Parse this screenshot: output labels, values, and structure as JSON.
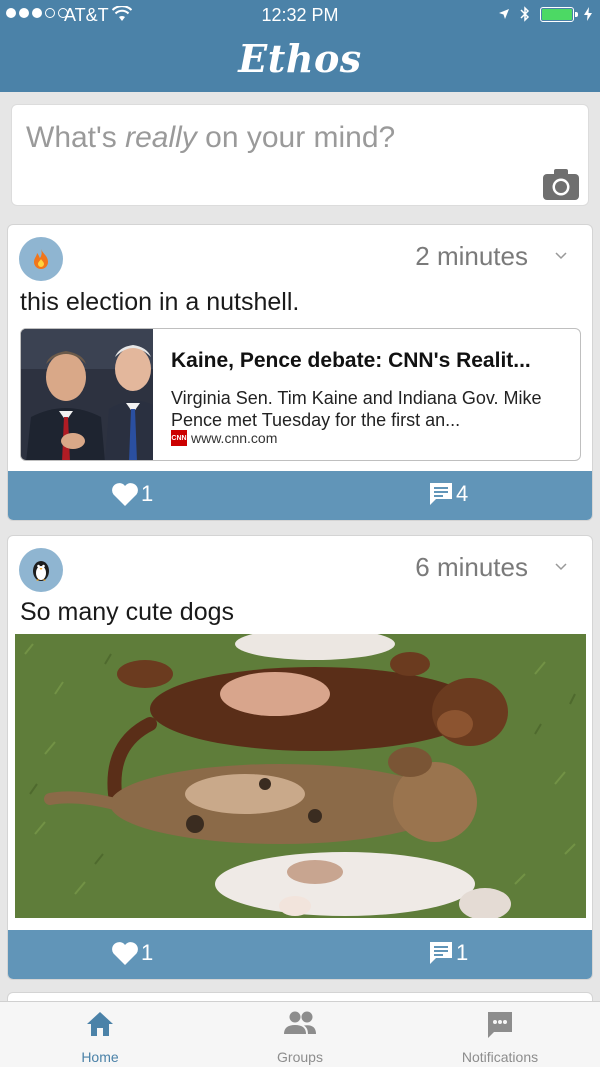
{
  "status_bar": {
    "carrier": "AT&T",
    "time": "12:32 PM"
  },
  "app": {
    "title": "Ethos"
  },
  "composer": {
    "placeholder_before": "What's ",
    "placeholder_emphasis": "really",
    "placeholder_after": " on your mind?",
    "camera_icon": "camera-icon"
  },
  "posts": [
    {
      "avatar_icon": "flame-icon",
      "time_ago": "2 minutes",
      "text": "this election in a nutshell.",
      "link": {
        "title": "Kaine, Pence debate: CNN's Realit...",
        "description": "Virginia Sen. Tim Kaine and Indiana Gov. Mike Pence met Tuesday for the first an...",
        "domain": "www.cnn.com",
        "badge": "CNN"
      },
      "likes": "1",
      "comments": "4"
    },
    {
      "avatar_icon": "penguin-icon",
      "time_ago": "6 minutes",
      "text": "So many cute dogs",
      "likes": "1",
      "comments": "1"
    }
  ],
  "tabs": [
    {
      "label": "Home",
      "icon": "home-icon",
      "active": true
    },
    {
      "label": "Groups",
      "icon": "groups-icon",
      "active": false
    },
    {
      "label": "Notifications",
      "icon": "chat-icon",
      "active": false
    }
  ],
  "colors": {
    "header": "#4b82a8",
    "action_bar": "#6195b8",
    "battery": "#4cd964"
  }
}
